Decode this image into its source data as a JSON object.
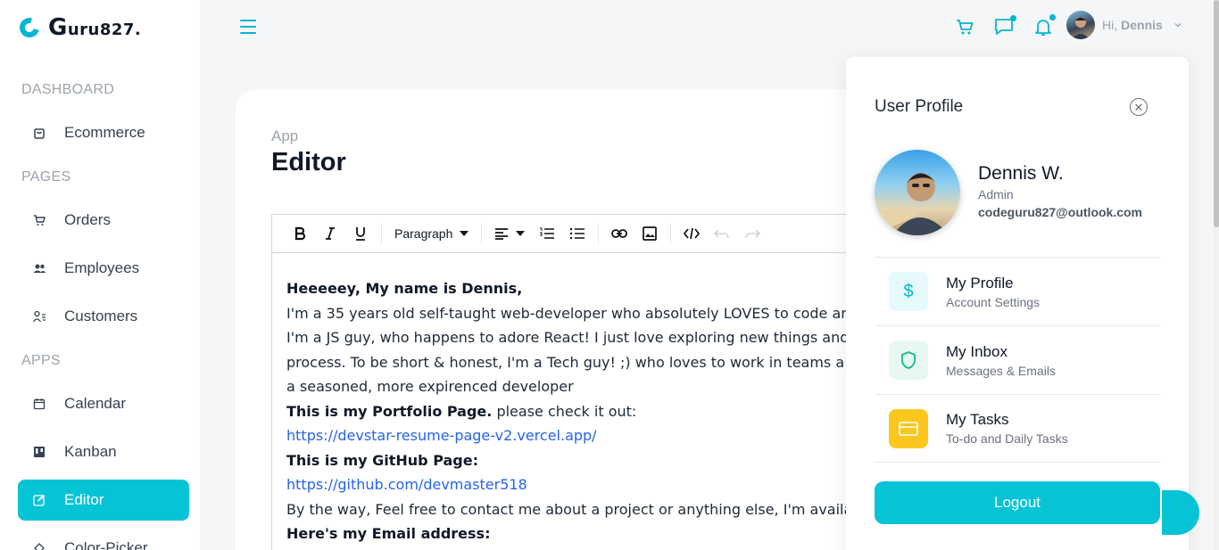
{
  "brand": {
    "initial": "G",
    "rest": "uru827."
  },
  "sidebar": {
    "sections": [
      "DASHBOARD",
      "PAGES",
      "APPS"
    ],
    "items": [
      {
        "label": "Ecommerce",
        "icon": "bag-icon"
      },
      {
        "label": "Orders",
        "icon": "cart-icon"
      },
      {
        "label": "Employees",
        "icon": "people-icon"
      },
      {
        "label": "Customers",
        "icon": "user-list-icon"
      },
      {
        "label": "Calendar",
        "icon": "calendar-icon"
      },
      {
        "label": "Kanban",
        "icon": "kanban-icon"
      },
      {
        "label": "Editor",
        "icon": "edit-icon",
        "active": true
      },
      {
        "label": "Color-Picker",
        "icon": "dropper-icon"
      }
    ]
  },
  "topbar": {
    "greeting": "Hi,",
    "username": "Dennis"
  },
  "page": {
    "breadcrumb": "App",
    "title": "Editor"
  },
  "toolbar": {
    "block_format": "Paragraph"
  },
  "editor": {
    "line1": "Heeeeey, My name is Dennis,",
    "line2": "I'm a 35 years old self-taught web-developer who absolutely LOVES to code ar",
    "line3": "I'm a JS guy, who happens to adore React! I just love exploring new things and",
    "line4": "process. To be short & honest, I'm a Tech guy! ;) who loves to work in teams a",
    "line5": "a seasoned, more expirenced developer",
    "portfolio_bold": "This is my Portfolio Page.",
    "portfolio_rest": " please check it out:",
    "portfolio_link": "https://devstar-resume-page-v2.vercel.app/",
    "github_bold": "This is my GitHub Page:",
    "github_link": "https://github.com/devmaster518",
    "contact": "By the way, Feel free to contact me about a project or anything else, I'm availa",
    "email_bold": "Here's my Email address:"
  },
  "profile": {
    "title": "User Profile",
    "name": "Dennis W.",
    "role": "Admin",
    "email": "codeguru827@outlook.com",
    "menu": [
      {
        "title": "My Profile",
        "subtitle": "Account Settings",
        "icon": "dollar-icon",
        "bg": "#e6f9fb",
        "fg": "#06b6d4"
      },
      {
        "title": "My Inbox",
        "subtitle": "Messages & Emails",
        "icon": "shield-icon",
        "bg": "#e7f8f2",
        "fg": "#10b981"
      },
      {
        "title": "My Tasks",
        "subtitle": "To-do and Daily Tasks",
        "icon": "card-icon",
        "bg": "#fbc71f",
        "fg": "#ffffff"
      }
    ],
    "logout": "Logout"
  },
  "colors": {
    "accent": "#06c3d6"
  }
}
